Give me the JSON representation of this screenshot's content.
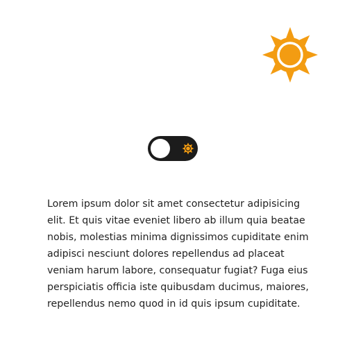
{
  "colors": {
    "accent": "#f39c12",
    "toggle_track": "#1c1c1c",
    "toggle_knob": "#ffffff",
    "text": "#222222",
    "background": "#ffffff"
  },
  "header": {
    "logo_icon": "sun-icon"
  },
  "theme_toggle": {
    "state": "off",
    "icon": "sun-icon"
  },
  "content": {
    "paragraph": "Lorem ipsum dolor sit amet consectetur adipisicing elit. Et quis vitae eveniet libero ab illum quia beatae nobis, molestias minima dignissimos cupiditate enim adipisci nesciunt dolores repellendus ad placeat veniam harum labore, consequatur fugiat? Fuga eius perspiciatis officia iste quibusdam ducimus, maiores, repellendus nemo quod in id quis ipsum cupiditate."
  }
}
